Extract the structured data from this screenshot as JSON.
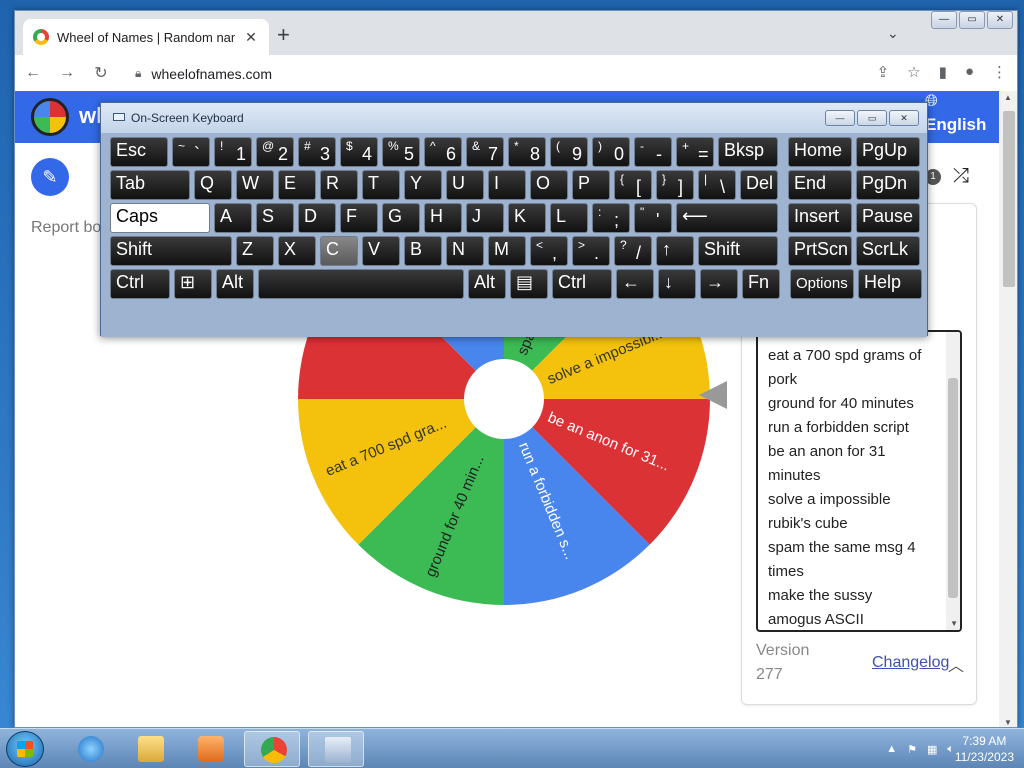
{
  "browser": {
    "tab_title": "Wheel of Names | Random name",
    "url": "wheelofnames.com",
    "new_tab": "+",
    "close_tab": "✕"
  },
  "site": {
    "title": "wh",
    "language": "English",
    "report": "Report bo",
    "entry_count": "1"
  },
  "wheel": {
    "segments": [
      {
        "label": "spam the same msg 4 times",
        "display": "spam",
        "color": "#3cba54"
      },
      {
        "label": "solve a impossible rubik's cube",
        "display": "solve a impossibl...",
        "color": "#f4c20d"
      },
      {
        "label": "be an anon for 31 minutes",
        "display": "be an anon for 31...",
        "color": "#db3236"
      },
      {
        "label": "run a forbidden script",
        "display": "run a forbidden s...",
        "color": "#4885ed"
      },
      {
        "label": "ground for 40 minutes",
        "display": "ground for 40 min...",
        "color": "#3cba54"
      },
      {
        "label": "eat a 700 spd grams of pork",
        "display": "eat a 700 spd gra...",
        "color": "#f4c20d"
      },
      {
        "label": "make the sussy amogus ASCII",
        "display": "",
        "color": "#db3236"
      },
      {
        "label": "",
        "display": "",
        "color": "#4885ed"
      }
    ]
  },
  "entries": {
    "lines": [
      "eat a 700 spd grams of",
      "pork",
      "ground for 40 minutes",
      "run a forbidden script",
      "be an anon for 31",
      "minutes",
      "solve a impossible",
      "rubik's cube",
      "spam the same msg 4",
      "times",
      "make the sussy",
      "amogus ASCII"
    ]
  },
  "panel": {
    "version_label": "Version",
    "version_number": "277",
    "changelog": "Changelog"
  },
  "osk": {
    "title": "On-Screen Keyboard",
    "rows": [
      [
        {
          "label": "Esc",
          "w": 58
        },
        {
          "shift": "~",
          "base": "`",
          "w": 38
        },
        {
          "shift": "!",
          "base": "1",
          "w": 38
        },
        {
          "shift": "@",
          "base": "2",
          "w": 38
        },
        {
          "shift": "#",
          "base": "3",
          "w": 38
        },
        {
          "shift": "$",
          "base": "4",
          "w": 38
        },
        {
          "shift": "%",
          "base": "5",
          "w": 38
        },
        {
          "shift": "^",
          "base": "6",
          "w": 38
        },
        {
          "shift": "&",
          "base": "7",
          "w": 38
        },
        {
          "shift": "*",
          "base": "8",
          "w": 38
        },
        {
          "shift": "(",
          "base": "9",
          "w": 38
        },
        {
          "shift": ")",
          "base": "0",
          "w": 38
        },
        {
          "shift": "-",
          "base": "-",
          "w": 38
        },
        {
          "shift": "+",
          "base": "=",
          "w": 38
        },
        {
          "label": "Bksp",
          "w": 60
        },
        {
          "label": "Home",
          "w": 64,
          "gap": 6
        },
        {
          "label": "PgUp",
          "w": 64
        }
      ],
      [
        {
          "label": "Tab",
          "w": 80
        },
        {
          "label": "Q",
          "w": 38
        },
        {
          "label": "W",
          "w": 38
        },
        {
          "label": "E",
          "w": 38
        },
        {
          "label": "R",
          "w": 38
        },
        {
          "label": "T",
          "w": 38
        },
        {
          "label": "Y",
          "w": 38
        },
        {
          "label": "U",
          "w": 38
        },
        {
          "label": "I",
          "w": 38
        },
        {
          "label": "O",
          "w": 38
        },
        {
          "label": "P",
          "w": 38
        },
        {
          "shift": "{",
          "base": "[",
          "w": 38
        },
        {
          "shift": "}",
          "base": "]",
          "w": 38
        },
        {
          "shift": "|",
          "base": "\\",
          "w": 38
        },
        {
          "label": "Del",
          "w": 38
        },
        {
          "label": "End",
          "w": 64,
          "gap": 6
        },
        {
          "label": "PgDn",
          "w": 64
        }
      ],
      [
        {
          "label": "Caps",
          "w": 100,
          "light": true
        },
        {
          "label": "A",
          "w": 38
        },
        {
          "label": "S",
          "w": 38
        },
        {
          "label": "D",
          "w": 38
        },
        {
          "label": "F",
          "w": 38
        },
        {
          "label": "G",
          "w": 38
        },
        {
          "label": "H",
          "w": 38
        },
        {
          "label": "J",
          "w": 38
        },
        {
          "label": "K",
          "w": 38
        },
        {
          "label": "L",
          "w": 38
        },
        {
          "shift": ":",
          "base": ";",
          "w": 38
        },
        {
          "shift": "\"",
          "base": "'",
          "w": 38
        },
        {
          "label": "⟵",
          "w": 102
        },
        {
          "label": "Insert",
          "w": 64,
          "gap": 6
        },
        {
          "label": "Pause",
          "w": 64
        }
      ],
      [
        {
          "label": "Shift",
          "w": 122
        },
        {
          "label": "Z",
          "w": 38
        },
        {
          "label": "X",
          "w": 38
        },
        {
          "label": "C",
          "w": 38,
          "hover": true
        },
        {
          "label": "V",
          "w": 38
        },
        {
          "label": "B",
          "w": 38
        },
        {
          "label": "N",
          "w": 38
        },
        {
          "label": "M",
          "w": 38
        },
        {
          "shift": "<",
          "base": ",",
          "w": 38
        },
        {
          "shift": ">",
          "base": ".",
          "w": 38
        },
        {
          "shift": "?",
          "base": "/",
          "w": 38
        },
        {
          "label": "↑",
          "w": 38
        },
        {
          "label": "Shift",
          "w": 80
        },
        {
          "label": "PrtScn",
          "w": 64,
          "gap": 6
        },
        {
          "label": "ScrLk",
          "w": 64
        }
      ],
      [
        {
          "label": "Ctrl",
          "w": 60
        },
        {
          "label": "⊞",
          "w": 38
        },
        {
          "label": "Alt",
          "w": 38
        },
        {
          "label": "",
          "w": 206
        },
        {
          "label": "Alt",
          "w": 38
        },
        {
          "label": "▤",
          "w": 38
        },
        {
          "label": "Ctrl",
          "w": 60
        },
        {
          "label": "←",
          "w": 38
        },
        {
          "label": "↓",
          "w": 38
        },
        {
          "label": "→",
          "w": 38
        },
        {
          "label": "Fn",
          "w": 38
        },
        {
          "label": "Options",
          "w": 64,
          "gap": 6,
          "small": true
        },
        {
          "label": "Help",
          "w": 64
        }
      ]
    ]
  },
  "taskbar": {
    "time": "7:39 AM",
    "date": "11/23/2023"
  }
}
